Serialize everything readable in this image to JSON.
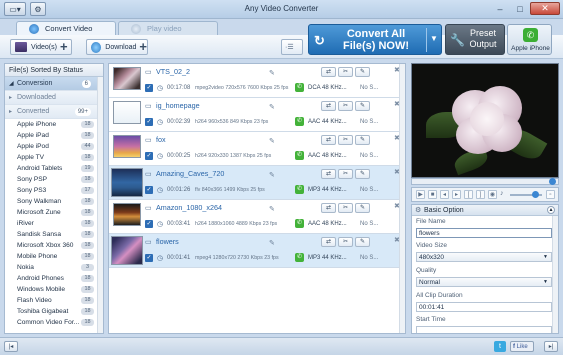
{
  "window": {
    "title": "Any Video Converter",
    "minimize": "–",
    "maximize": "□",
    "close": "✕"
  },
  "tabs": [
    {
      "label": "Convert Video",
      "active": true
    },
    {
      "label": "Play video",
      "active": false
    }
  ],
  "toolbar": {
    "add_videos": "Video(s)",
    "download": "Download",
    "convert_all": "Convert All File(s) NOW!",
    "preset_output": "Preset Output",
    "profile": "Apple iPhone"
  },
  "sidebar": {
    "header": "File(s) Sorted By Status",
    "groups": [
      {
        "label": "Conversion",
        "count": "6",
        "selected": true
      },
      {
        "label": "Downloaded",
        "count": "",
        "selected": false
      },
      {
        "label": "Converted",
        "count": "99+",
        "selected": false
      }
    ],
    "devices": [
      {
        "label": "Apple iPhone",
        "count": "18"
      },
      {
        "label": "Apple iPad",
        "count": "18"
      },
      {
        "label": "Apple iPod",
        "count": "44"
      },
      {
        "label": "Apple TV",
        "count": "18"
      },
      {
        "label": "Android Tablets",
        "count": "19"
      },
      {
        "label": "Sony PSP",
        "count": "18"
      },
      {
        "label": "Sony PS3",
        "count": "17"
      },
      {
        "label": "Sony Walkman",
        "count": "18"
      },
      {
        "label": "Microsoft Zune",
        "count": "18"
      },
      {
        "label": "iRiver",
        "count": "18"
      },
      {
        "label": "Sandisk Sansa",
        "count": "18"
      },
      {
        "label": "Microsoft Xbox 360",
        "count": "18"
      },
      {
        "label": "Mobile Phone",
        "count": "18"
      },
      {
        "label": "Nokia",
        "count": "3"
      },
      {
        "label": "Android Phones",
        "count": "18"
      },
      {
        "label": "Windows Mobile",
        "count": "18"
      },
      {
        "label": "Flash Video",
        "count": "18"
      },
      {
        "label": "Toshiba Gigabeat",
        "count": "18"
      },
      {
        "label": "Common Video For...",
        "count": "18"
      }
    ]
  },
  "files": [
    {
      "name": "VTS_02_2",
      "duration": "00:17:08",
      "info": "mpeg2video 720x576 7600 Kbps 25 fps",
      "audio": "DCA 48 KHz...",
      "subtitle": "No S...",
      "thumb": "t-pink",
      "tile": false,
      "selected": false
    },
    {
      "name": "ig_homepage",
      "duration": "00:02:39",
      "info": "h264 960x536 849 Kbps 23 fps",
      "audio": "AAC 44 KHz...",
      "subtitle": "No S...",
      "thumb": "t-ig",
      "tile": false,
      "selected": false
    },
    {
      "name": "fox",
      "duration": "00:00:25",
      "info": "h264 920x330 1387 Kbps 25 fps",
      "audio": "AAC 48 KHz...",
      "subtitle": "No S...",
      "thumb": "t-fox",
      "tile": false,
      "selected": false
    },
    {
      "name": "Amazing_Caves_720",
      "duration": "00:01:26",
      "info": "flv 840x366 1499 Kbps 25 fps",
      "audio": "MP3 44 KHz...",
      "subtitle": "No S...",
      "thumb": "t-cave",
      "tile": true,
      "selected": true
    },
    {
      "name": "Amazon_1080_x264",
      "duration": "00:03:41",
      "info": "h264 1880x1060 4889 Kbps 23 fps",
      "audio": "AAC 48 KHz...",
      "subtitle": "No S...",
      "thumb": "t-amz",
      "tile": false,
      "selected": false
    },
    {
      "name": "flowers",
      "duration": "00:01:41",
      "info": "mpeg4 1280x720 2730 Kbps 23 fps",
      "audio": "MP3 44 KHz...",
      "subtitle": "No S...",
      "thumb": "t-flw",
      "tile": true,
      "selected": true
    }
  ],
  "options": {
    "header": "Basic Option",
    "file_name_label": "File Name",
    "file_name_value": "flowers",
    "video_size_label": "Video Size",
    "video_size_value": "480x320",
    "quality_label": "Quality",
    "quality_value": "Normal",
    "all_clip_duration_label": "All Clip Duration",
    "all_clip_duration_value": "00:01:41",
    "start_time_label": "Start Time"
  },
  "statusbar": {
    "like": "Like"
  },
  "colors": {
    "accent": "#2a70b8",
    "selected_row": "#d8e9f8",
    "phone_green": "#43b239"
  }
}
